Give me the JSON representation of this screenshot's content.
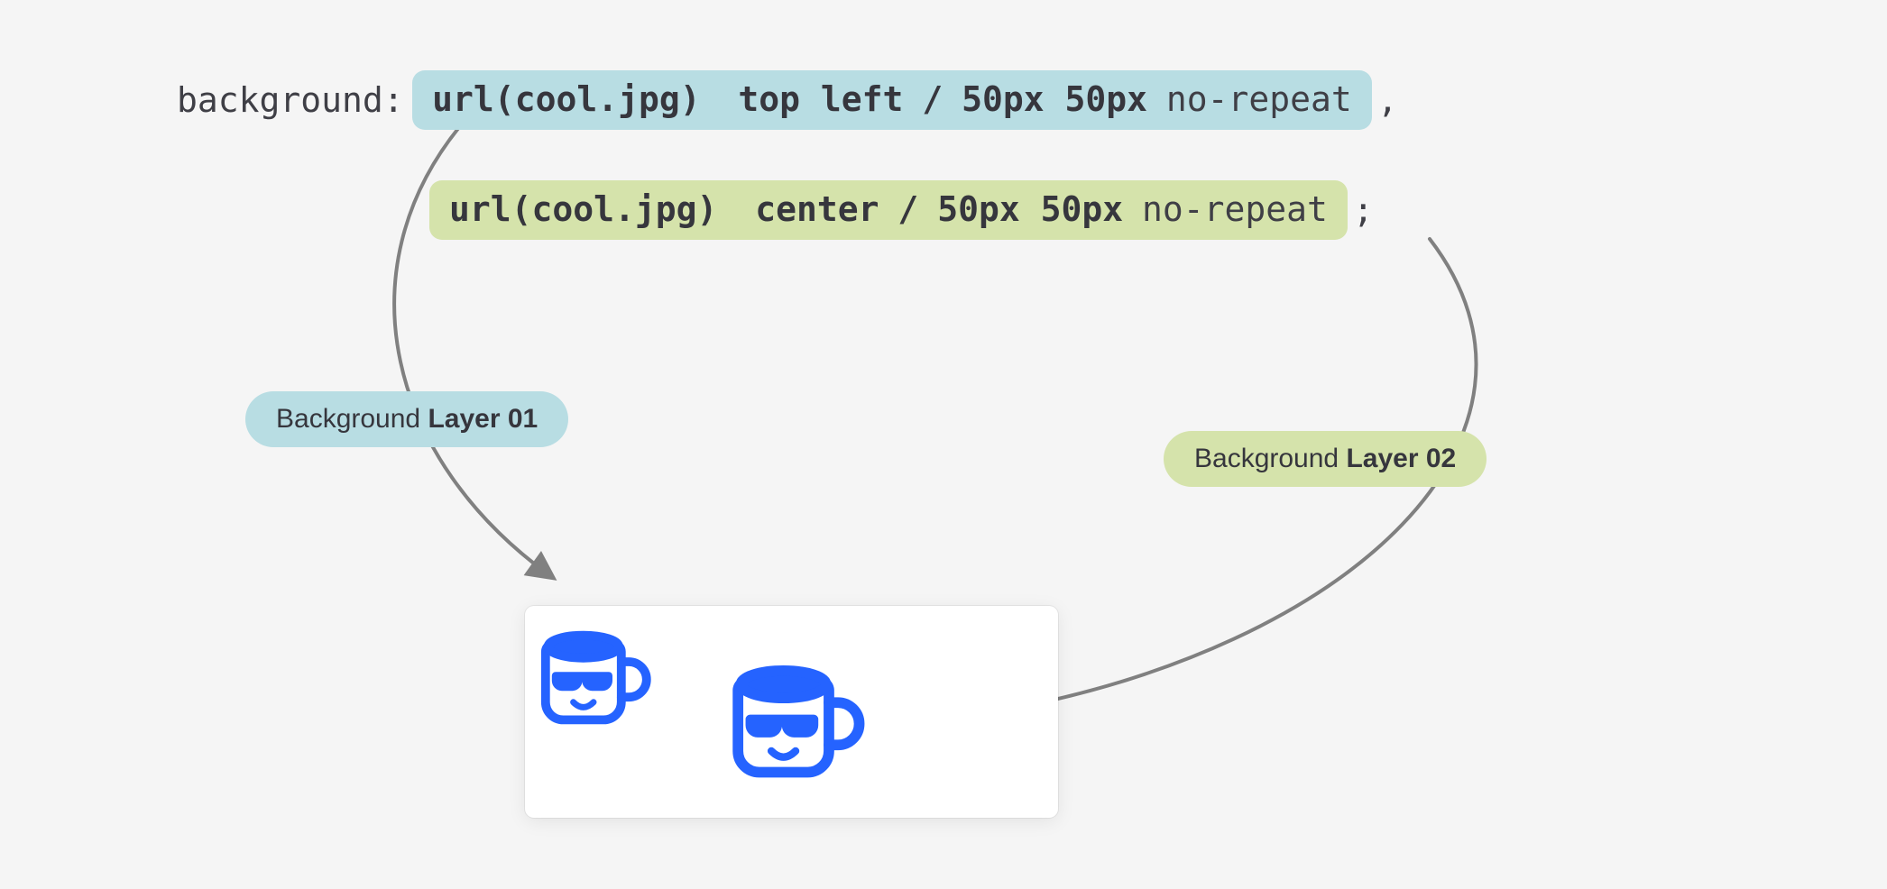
{
  "code": {
    "property": "background:",
    "layer1": {
      "url_open": "url(",
      "file": "cool.jpg",
      "url_close": ")",
      "position": "top left",
      "slash": "/",
      "size": "50px 50px",
      "repeat": "no-repeat",
      "trailing": ","
    },
    "layer2": {
      "url_open": "url(",
      "file": "cool.jpg",
      "url_close": ")",
      "position": "center",
      "slash": "/",
      "size": "50px 50px",
      "repeat": "no-repeat",
      "trailing": ";"
    }
  },
  "labels": {
    "layer1_prefix": "Background ",
    "layer1_bold": "Layer 01",
    "layer2_prefix": "Background ",
    "layer2_bold": "Layer 02"
  },
  "colors": {
    "blue_hl": "#b8dde3",
    "green_hl": "#d5e3ab",
    "arrow": "#808080",
    "mug": "#2563ff"
  }
}
